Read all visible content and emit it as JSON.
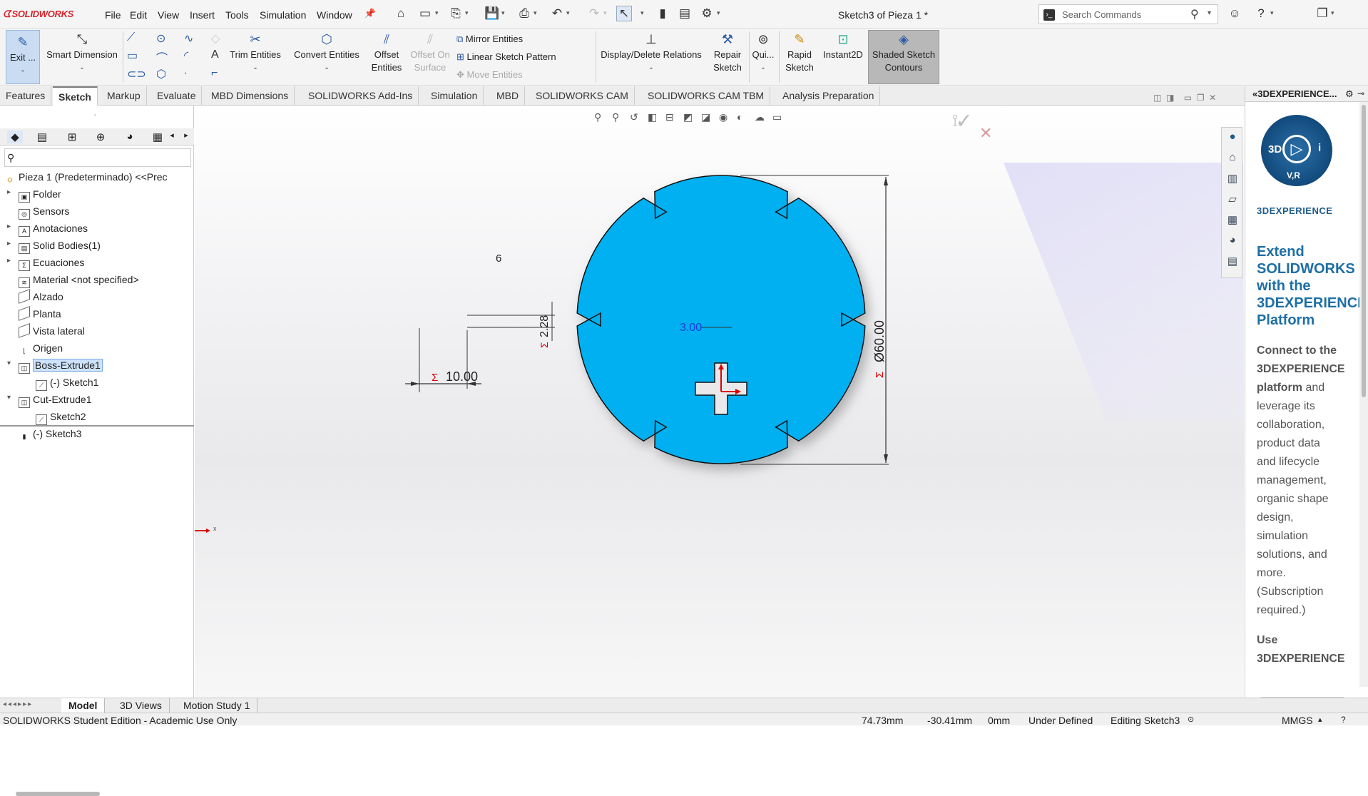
{
  "app": {
    "logo_text": "SOLIDWORKS",
    "doc_title": "Sketch3 of Pieza 1 *"
  },
  "menu": [
    "File",
    "Edit",
    "View",
    "Insert",
    "Tools",
    "Simulation",
    "Window"
  ],
  "search": {
    "placeholder": "Search Commands"
  },
  "ribbon": {
    "exit": "Exit ...",
    "smart_dimension": "Smart Dimension",
    "trim": "Trim Entities",
    "convert": "Convert Entities",
    "offset_1": "Offset",
    "offset_2": "Entities",
    "offset_surface_1": "Offset On",
    "offset_surface_2": "Surface",
    "mirror": "Mirror Entities",
    "linear_pattern": "Linear Sketch Pattern",
    "move": "Move Entities",
    "display_relations": "Display/Delete Relations",
    "repair_1": "Repair",
    "repair_2": "Sketch",
    "quick": "Qui...",
    "rapid_1": "Rapid",
    "rapid_2": "Sketch",
    "instant2d": "Instant2D",
    "shaded_1": "Shaded Sketch",
    "shaded_2": "Contours"
  },
  "tabs": [
    "Features",
    "Sketch",
    "Markup",
    "Evaluate",
    "MBD Dimensions",
    "SOLIDWORKS Add-Ins",
    "Simulation",
    "MBD",
    "SOLIDWORKS CAM",
    "SOLIDWORKS CAM TBM",
    "Analysis Preparation"
  ],
  "active_tab": "Sketch",
  "tree": {
    "root": "Pieza 1 (Predeterminado) <<Prec",
    "items": [
      "Folder",
      "Sensors",
      "Anotaciones",
      "Solid Bodies(1)",
      "Ecuaciones",
      "Material <not specified>",
      "Alzado",
      "Planta",
      "Vista lateral",
      "Origen",
      "Boss-Extrude1",
      "(-) Sketch1",
      "Cut-Extrude1",
      "Sketch2",
      "(-) Sketch3"
    ]
  },
  "sketch": {
    "dim_diameter": "Ø60.00",
    "dim_width": "10.00",
    "dim_small": "2.28",
    "dim_slot": "3.00",
    "label_six": "6",
    "sigma": "Σ",
    "axis_x": "x",
    "axis_y": "z",
    "fill_color": "#00b0f0"
  },
  "right_pane": {
    "title": "3DEXPERIENCE...",
    "compass_3d": "3D",
    "compass_i": "i",
    "compass_vr": "V,R",
    "brand": "3DEXPERIENCE",
    "headline": [
      "Extend",
      "SOLIDWORKS",
      "with the",
      "3DEXPERIENCE",
      "Platform"
    ],
    "body_bold_1": "Connect to the",
    "body_bold_2": "3DEXPERIENCE",
    "body_bold_3": "platform",
    "body_and": "and",
    "body_lines": [
      "leverage its",
      "collaboration,",
      "product data",
      "and lifecycle",
      "management,",
      "organic shape",
      "design,",
      "simulation",
      "solutions, and",
      "more.",
      "(Subscription",
      "required.)"
    ],
    "use_1": "Use",
    "use_2": "3DEXPERIENCE"
  },
  "bottom_tabs": [
    "Model",
    "3D Views",
    "Motion Study 1"
  ],
  "status": {
    "edition": "SOLIDWORKS Student Edition - Academic Use Only",
    "x": "74.73mm",
    "y": "-30.41mm",
    "z": "0mm",
    "state": "Under Defined",
    "editing": "Editing Sketch3",
    "units": "MMGS"
  }
}
